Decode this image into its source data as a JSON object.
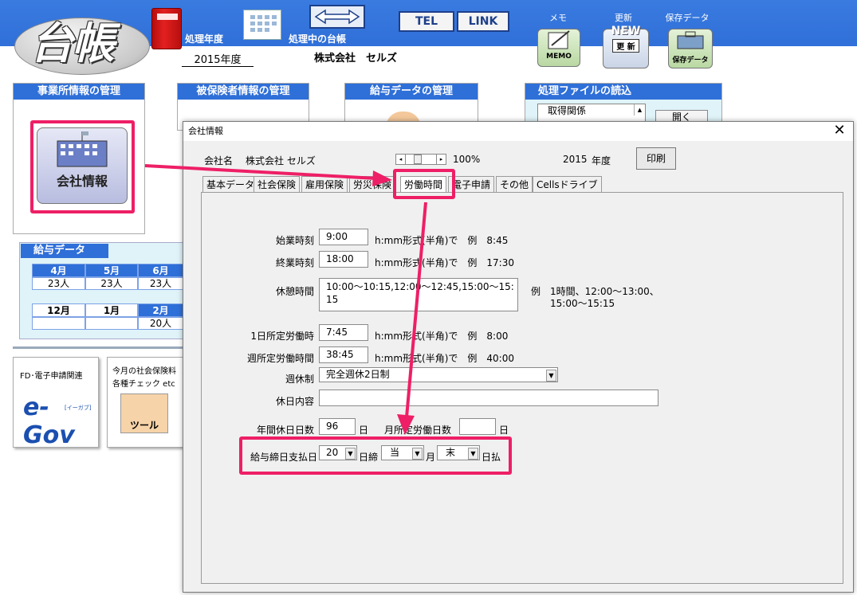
{
  "header": {
    "logo": "台帳",
    "year_label": "処理年度",
    "year_value": "2015年度",
    "ledger_label": "処理中の台帳",
    "ledger_value": "株式会社　セルズ",
    "tel_button": "TEL",
    "link_button": "LINK",
    "memo_label": "メモ",
    "memo_icon_text": "MEMO",
    "update_label": "更新",
    "update_icon_top": "NEW",
    "update_icon_text": "更 新",
    "save_label": "保存データ",
    "save_icon_text": "保存データ"
  },
  "panels": {
    "office": "事業所情報の管理",
    "insured": "被保険者情報の管理",
    "salary": "給与データの管理",
    "files": "処理ファイルの読込",
    "company_button": "会社情報",
    "file_list_item": "取得関係",
    "open_button": "開く"
  },
  "salary_data": {
    "title": "給与データ",
    "row1": {
      "months": [
        "4月",
        "5月",
        "6月"
      ],
      "values": [
        "23人",
        "23人",
        "23人"
      ]
    },
    "row2": {
      "months": [
        "12月",
        "1月",
        "2月"
      ],
      "values": [
        "",
        "",
        "20人"
      ]
    }
  },
  "bottom": {
    "fd_label": "FD･電子申請関連",
    "egov_text": "e-Gov",
    "egov_sub": "[イーガブ]",
    "tool_line1": "今月の社会保険料",
    "tool_line2": "各種チェック etc",
    "tool_text": "ツール"
  },
  "dialog": {
    "title": "会社情報",
    "close": "✕",
    "company_label": "会社名",
    "company_value": "株式会社 セルズ",
    "zoom": "100%",
    "year": "2015",
    "year_unit": "年度",
    "print": "印刷",
    "tabs": [
      "基本データ",
      "社会保険",
      "雇用保険",
      "労災保険",
      "労働時間",
      "電子申請",
      "その他",
      "Cellsドライブ"
    ],
    "fields": {
      "start_label": "始業時刻",
      "start_value": "9:00",
      "start_hint": "h:mm形式(半角)で　例　8:45",
      "end_label": "終業時刻",
      "end_value": "18:00",
      "end_hint": "h:mm形式(半角)で　例　17:30",
      "break_label": "休憩時間",
      "break_value": "10:00～10:15,12:00～12:45,15:00～15:15",
      "break_hint1": "例　1時間、12:00～13:00、",
      "break_hint2": "15:00～15:15",
      "daily_label": "1日所定労働時",
      "daily_value": "7:45",
      "daily_hint": "h:mm形式(半角)で　例　8:00",
      "weekly_label": "週所定労働時間",
      "weekly_value": "38:45",
      "weekly_hint": "h:mm形式(半角)で　例　40:00",
      "weekoff_label": "週休制",
      "weekoff_value": "完全週休2日制",
      "holiday_label": "休日内容",
      "holiday_value": "",
      "annual_label": "年間休日日数",
      "annual_value": "96",
      "annual_unit": "日",
      "monthly_label": "月所定労働日数",
      "monthly_value": "",
      "monthly_unit": "日",
      "pay_label": "給与締日支払日",
      "pay_close": "20",
      "pay_close_unit": "日締",
      "pay_month": "当",
      "pay_month_unit": "月",
      "pay_day": "末",
      "pay_day_unit": "日払"
    }
  },
  "colors": {
    "accent": "#2f6fd8",
    "highlight": "#ee1f66"
  }
}
